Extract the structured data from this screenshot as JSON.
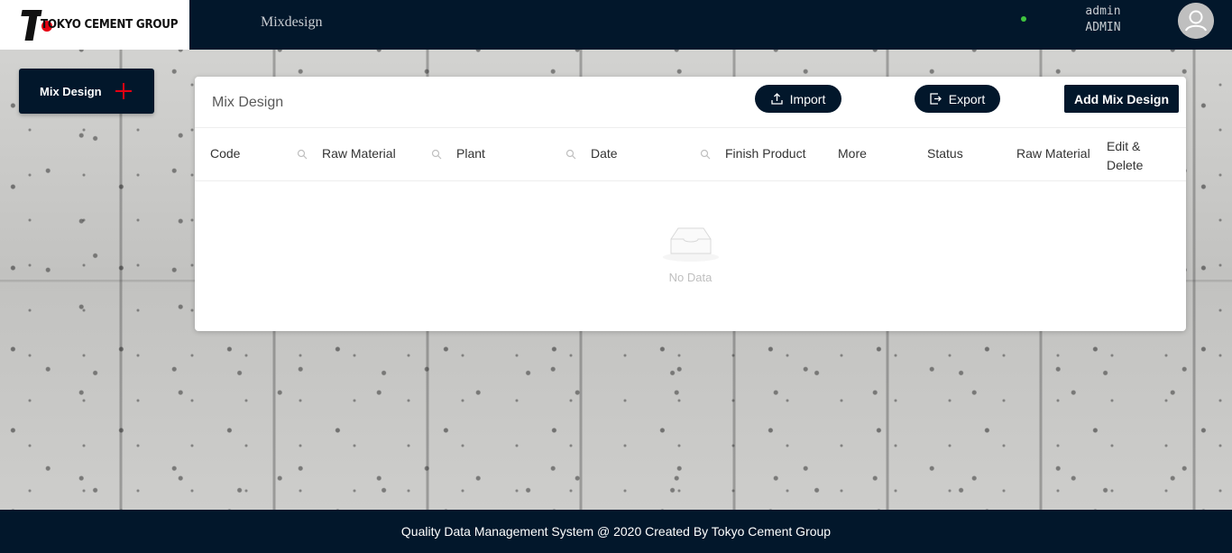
{
  "header": {
    "logo_text": "TOKYO CEMENT GROUP",
    "page_name": "Mixdesign",
    "user": {
      "name": "admin",
      "role": "ADMIN",
      "status_color": "#3fc43f"
    }
  },
  "sidebar": {
    "mix_design_label": "Mix Design"
  },
  "card": {
    "title": "Mix Design",
    "import_label": "Import",
    "export_label": "Export",
    "add_label": "Add Mix Design",
    "columns": [
      {
        "label": "Code",
        "searchable": true
      },
      {
        "label": "Raw Material",
        "searchable": true
      },
      {
        "label": "Plant",
        "searchable": true
      },
      {
        "label": "Date",
        "searchable": true
      },
      {
        "label": "Finish Product",
        "searchable": false
      },
      {
        "label": "More",
        "searchable": false
      },
      {
        "label": "Status",
        "searchable": false
      },
      {
        "label": "Raw Material",
        "searchable": false
      },
      {
        "label": "Edit & Delete",
        "searchable": false
      }
    ],
    "rows": [],
    "empty_text": "No Data"
  },
  "footer": {
    "text": "Quality Data Management System @ 2020 Created By Tokyo Cement Group"
  },
  "colors": {
    "navy": "#02172b",
    "accent_red": "#e60012"
  }
}
